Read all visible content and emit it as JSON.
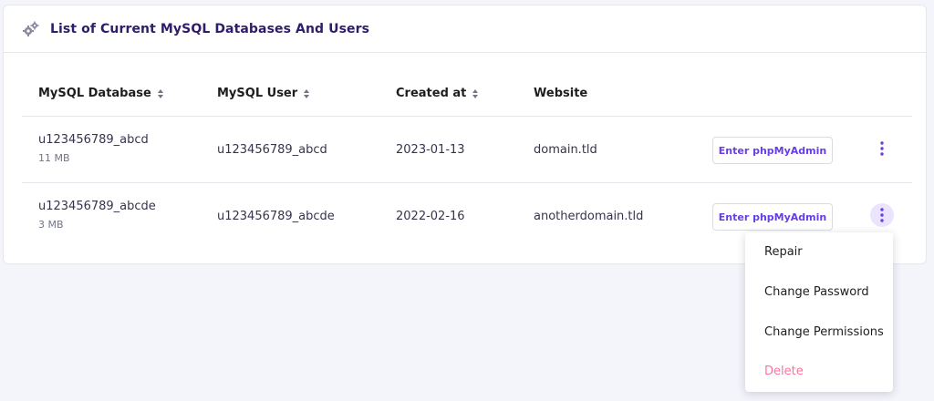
{
  "card": {
    "title": "List of Current MySQL Databases And Users",
    "icon": "gears-icon"
  },
  "table": {
    "headers": [
      {
        "label": "MySQL Database",
        "sortable": true
      },
      {
        "label": "MySQL User",
        "sortable": true
      },
      {
        "label": "Created at",
        "sortable": true
      },
      {
        "label": "Website",
        "sortable": false
      }
    ],
    "rows": [
      {
        "database": "u123456789_abcd",
        "size": "11 MB",
        "user": "u123456789_abcd",
        "created": "2023-01-13",
        "website": "domain.tld",
        "action_label": "Enter phpMyAdmin"
      },
      {
        "database": "u123456789_abcde",
        "size": "3 MB",
        "user": "u123456789_abcde",
        "created": "2022-02-16",
        "website": "anotherdomain.tld",
        "action_label": "Enter phpMyAdmin"
      }
    ]
  },
  "context_menu": {
    "items": [
      "Repair",
      "Change Password",
      "Change Permissions",
      "Delete"
    ]
  },
  "colors": {
    "accent": "#673de6",
    "title": "#2f1c6a",
    "danger": "#fc5185",
    "background": "#f4f4fb"
  }
}
